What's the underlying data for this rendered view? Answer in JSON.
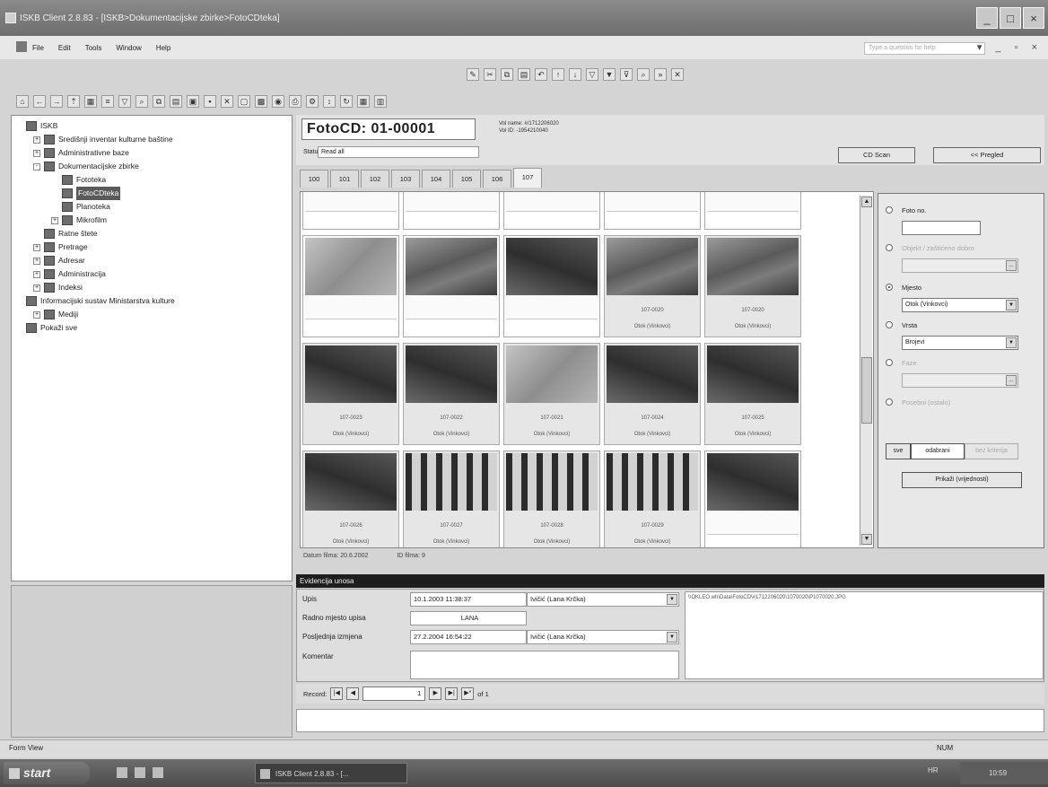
{
  "window": {
    "title": "ISKB Client 2.8.83 - [ISKB>Dokumentacijske zbirke>FotoCDteka]"
  },
  "menu": [
    "File",
    "Edit",
    "Tools",
    "Window",
    "Help"
  ],
  "help_placeholder": "Type a question for help",
  "tree": [
    {
      "label": "ISKB",
      "depth": 0,
      "expander": "",
      "selected": false
    },
    {
      "label": "Središnji inventar kulturne baštine",
      "depth": 1,
      "expander": "+",
      "selected": false
    },
    {
      "label": "Administrativne baze",
      "depth": 1,
      "expander": "+",
      "selected": false
    },
    {
      "label": "Dokumentacijske zbirke",
      "depth": 1,
      "expander": "-",
      "selected": false
    },
    {
      "label": "Fototeka",
      "depth": 2,
      "expander": "",
      "selected": false
    },
    {
      "label": "FotoCDteka",
      "depth": 2,
      "expander": "",
      "selected": true
    },
    {
      "label": "Planoteka",
      "depth": 2,
      "expander": "",
      "selected": false
    },
    {
      "label": "Mikrofilm",
      "depth": 2,
      "expander": "+",
      "selected": false
    },
    {
      "label": "Ratne štete",
      "depth": 1,
      "expander": "",
      "selected": false
    },
    {
      "label": "Pretrage",
      "depth": 1,
      "expander": "+",
      "selected": false
    },
    {
      "label": "Adresar",
      "depth": 1,
      "expander": "+",
      "selected": false
    },
    {
      "label": "Administracija",
      "depth": 1,
      "expander": "+",
      "selected": false
    },
    {
      "label": "Indeksi",
      "depth": 1,
      "expander": "+",
      "selected": false
    },
    {
      "label": "Informacijski sustav Ministarstva kulture",
      "depth": 0,
      "expander": "",
      "selected": false
    },
    {
      "label": "Mediji",
      "depth": 1,
      "expander": "+",
      "selected": false
    },
    {
      "label": "Pokaži sve",
      "depth": 0,
      "expander": "",
      "selected": false
    }
  ],
  "form": {
    "title": "FotoCD:  01-00001",
    "status_label": "Status:",
    "status_value": "Read all",
    "vol_name": "Vol name:  #/1712206020",
    "vol_id": "Vol ID:       -1954210040",
    "cd_scan": "CD Scan",
    "pregled": "<< Pregled"
  },
  "tabs": [
    "100",
    "101",
    "102",
    "103",
    "104",
    "105",
    "106",
    "107"
  ],
  "active_tab": 7,
  "photos": [
    {
      "id": "",
      "caption": ""
    },
    {
      "id": "",
      "caption": ""
    },
    {
      "id": "",
      "caption": ""
    },
    {
      "id": "",
      "caption": ""
    },
    {
      "id": "",
      "caption": ""
    },
    {
      "id": "",
      "caption": ""
    },
    {
      "id": "",
      "caption": ""
    },
    {
      "id": "",
      "caption": ""
    },
    {
      "id": "107-0020",
      "caption": "Otok (Vinkovci)"
    },
    {
      "id": "107-0020",
      "caption": "Otok (Vinkovci)"
    },
    {
      "id": "107-0023",
      "caption": "Otok (Vinkovci)"
    },
    {
      "id": "107-0022",
      "caption": "Otok (Vinkovci)"
    },
    {
      "id": "107-0021",
      "caption": "Otok (Vinkovci)"
    },
    {
      "id": "107-0024",
      "caption": "Otok (Vinkovci)"
    },
    {
      "id": "107-0025",
      "caption": "Otok (Vinkovci)"
    },
    {
      "id": "107-0026",
      "caption": "Otok (Vinkovci)"
    },
    {
      "id": "107-0027",
      "caption": "Otok (Vinkovci)"
    },
    {
      "id": "107-0028",
      "caption": "Otok (Vinkovci)"
    },
    {
      "id": "107-0029",
      "caption": "Otok (Vinkovci)"
    },
    {
      "id": "",
      "caption": ""
    }
  ],
  "grid_footer": {
    "date": "Datum filma:  20.6.2002",
    "id": "ID filma:  9"
  },
  "filters": {
    "foto_no": "Foto no.",
    "objekt": "Objekt / zaštićeno dobro",
    "mjesto": "Mjesto",
    "mjesto_value": "Otok (Vinkovci)",
    "vrsta": "Vrsta",
    "vrsta_value": "Brojevi",
    "fase": "Faze",
    "posebni": "Posebni (ostalo)",
    "sve": "sve",
    "odabrani": "odabrani",
    "bez_kriterija": "bez kriterija",
    "prikazi": "Prikaži (vrijednosti)"
  },
  "evidencija": {
    "header": "Evidencija unosa",
    "upis_label": "Upis",
    "upis_date": "10.1.2003 11:38:37",
    "upis_user": "Ivičić (Lana Krčka)",
    "radno_label": "Radno mjesto upisa",
    "radno_value": "LANA",
    "izmjena_label": "Posljednja izmjena",
    "izmjena_date": "27.2.2004 16:54:22",
    "izmjena_user": "Ivičić (Lana Krčka)",
    "komentar_label": "Komentar",
    "path": "\\\\OKLEO.wh\\Data\\FotoCD\\#1712206020\\1070020\\P1070020.JPG"
  },
  "records": {
    "label": "Record:",
    "current": "1",
    "of": "of  1"
  },
  "status": {
    "left": "Form View",
    "right": "NUM"
  },
  "taskbar": {
    "start": "start",
    "item": "ISKB Client 2.8.83 - [...",
    "lang": "HR",
    "time": "10:59"
  }
}
